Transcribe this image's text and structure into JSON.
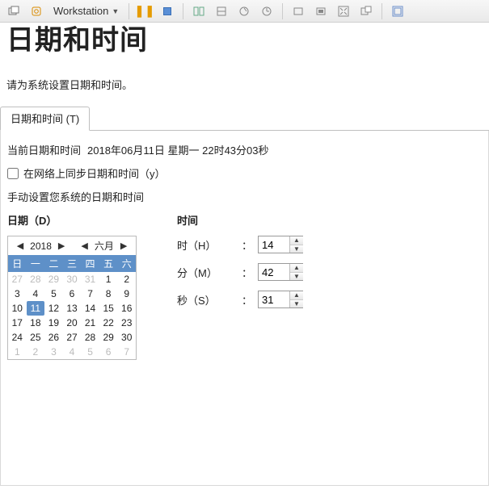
{
  "toolbar": {
    "workstation_label": "Workstation"
  },
  "header": {
    "title": "日期和时间",
    "subtitle": "请为系统设置日期和时间。"
  },
  "tab": {
    "label": "日期和时间 (T)"
  },
  "current": {
    "label": "当前日期和时间",
    "value": "2018年06月11日 星期一 22时43分03秒"
  },
  "sync": {
    "label": "在网络上同步日期和时间（y）",
    "checked": false
  },
  "manual_label": "手动设置您系统的日期和时间",
  "date": {
    "heading": "日期（D）",
    "year": "2018",
    "month": "六月",
    "weekdays": [
      "日",
      "一",
      "二",
      "三",
      "四",
      "五",
      "六"
    ],
    "leading": [
      27,
      28,
      29,
      30,
      31
    ],
    "days": [
      1,
      2,
      3,
      4,
      5,
      6,
      7,
      8,
      9,
      10,
      11,
      12,
      13,
      14,
      15,
      16,
      17,
      18,
      19,
      20,
      21,
      22,
      23,
      24,
      25,
      26,
      27,
      28,
      29,
      30
    ],
    "trailing": [
      1,
      2,
      3,
      4,
      5,
      6,
      7
    ],
    "selected": 11
  },
  "time": {
    "heading": "时间",
    "hour_label": "时（H）",
    "minute_label": "分（M）",
    "second_label": "秒（S）",
    "colon": "：",
    "hour": "14",
    "minute": "42",
    "second": "31"
  }
}
